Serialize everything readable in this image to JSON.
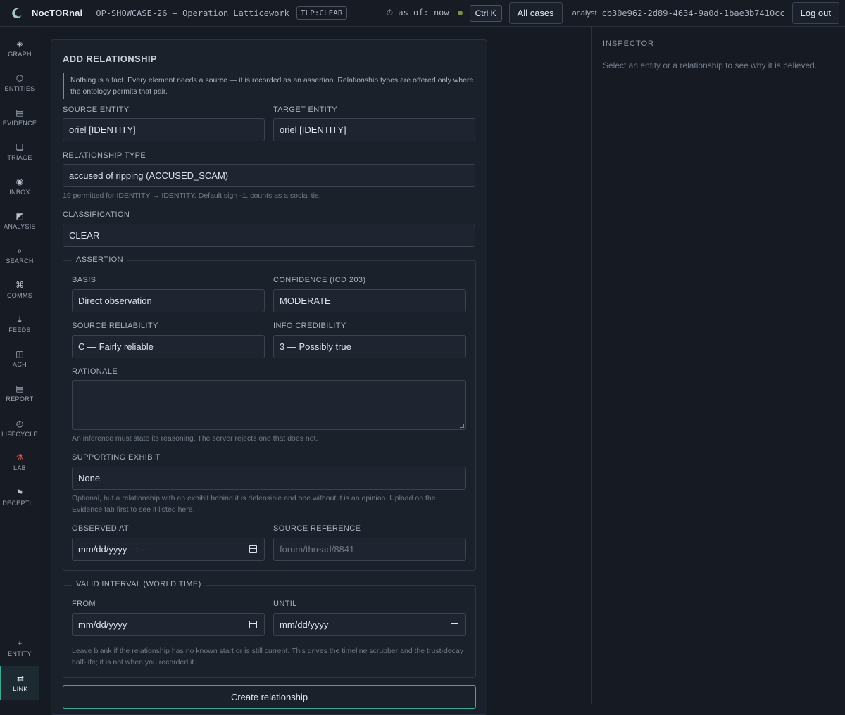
{
  "header": {
    "brand": "NocTORnal",
    "case_title": "OP-SHOWCASE-26 — Operation Latticework",
    "tlp": "TLP:CLEAR",
    "as_of": "⏱ as-of: now",
    "search_shortcut": "Ctrl K",
    "all_cases": "All cases",
    "analyst_label": "analyst",
    "analyst_id": "cb30e962-2d89-4634-9a0d-1bae3b7410cc",
    "logout": "Log out",
    "status_color": "#7c8a4a"
  },
  "sidebar": {
    "items": [
      {
        "icon": "◈",
        "label": "GRAPH"
      },
      {
        "icon": "⬡",
        "label": "ENTITIES"
      },
      {
        "icon": "▤",
        "label": "EVIDENCE"
      },
      {
        "icon": "❏",
        "label": "TRIAGE"
      },
      {
        "icon": "◉",
        "label": "INBOX"
      },
      {
        "icon": "◩",
        "label": "ANALYSIS"
      },
      {
        "icon": "⌕",
        "label": "SEARCH"
      },
      {
        "icon": "⌘",
        "label": "COMMS"
      },
      {
        "icon": "⇣",
        "label": "FEEDS"
      },
      {
        "icon": "◫",
        "label": "ACH"
      },
      {
        "icon": "▤",
        "label": "REPORT"
      },
      {
        "icon": "◴",
        "label": "LIFECYCLE"
      },
      {
        "icon": "⚗",
        "label": "LAB"
      },
      {
        "icon": "⚑",
        "label": "DECEPTI..."
      }
    ],
    "bottom": [
      {
        "icon": "+",
        "label": "ENTITY"
      },
      {
        "icon": "⇄",
        "label": "LINK"
      }
    ]
  },
  "form": {
    "title": "ADD RELATIONSHIP",
    "note": "Nothing is a fact. Every element needs a source — it is recorded as an assertion. Relationship types are offered only where the ontology permits that pair.",
    "source_entity_label": "SOURCE ENTITY",
    "source_entity": "oriel [IDENTITY]",
    "target_entity_label": "TARGET ENTITY",
    "target_entity": "oriel [IDENTITY]",
    "relationship_type_label": "RELATIONSHIP TYPE",
    "relationship_type": "accused of ripping (ACCUSED_SCAM)",
    "relationship_hint": "19 permitted for IDENTITY → IDENTITY. Default sign -1, counts as a social tie.",
    "classification_label": "CLASSIFICATION",
    "classification": "CLEAR",
    "assertion": {
      "legend": "ASSERTION",
      "basis_label": "BASIS",
      "basis": "Direct observation",
      "confidence_label": "CONFIDENCE (ICD 203)",
      "confidence": "MODERATE",
      "reliability_label": "SOURCE RELIABILITY",
      "reliability": "C — Fairly reliable",
      "credibility_label": "INFO CREDIBILITY",
      "credibility": "3 — Possibly true",
      "rationale_label": "RATIONALE",
      "rationale_hint": "An inference must state its reasoning. The server rejects one that does not.",
      "exhibit_label": "SUPPORTING EXHIBIT",
      "exhibit": "None",
      "exhibit_hint": "Optional, but a relationship with an exhibit behind it is defensible and one without it is an opinion. Upload on the Evidence tab first to see it listed here.",
      "observed_label": "OBSERVED AT",
      "observed_value": "mm/dd/yyyy --:-- --",
      "source_ref_label": "SOURCE REFERENCE",
      "source_ref_placeholder": "forum/thread/8841"
    },
    "interval": {
      "legend": "VALID INTERVAL (WORLD TIME)",
      "from_label": "FROM",
      "from_value": "mm/dd/yyyy",
      "until_label": "UNTIL",
      "until_value": "mm/dd/yyyy",
      "hint": "Leave blank if the relationship has no known start or is still current. This drives the timeline scrubber and the trust-decay half-life; it is not when you recorded it."
    },
    "submit": "Create relationship"
  },
  "inspector": {
    "title": "INSPECTOR",
    "empty_text": "Select an entity or a relationship to see why it is believed."
  },
  "colors": {
    "accent": "#3fa896",
    "background": "#151a23",
    "panel": "#1b212b"
  }
}
